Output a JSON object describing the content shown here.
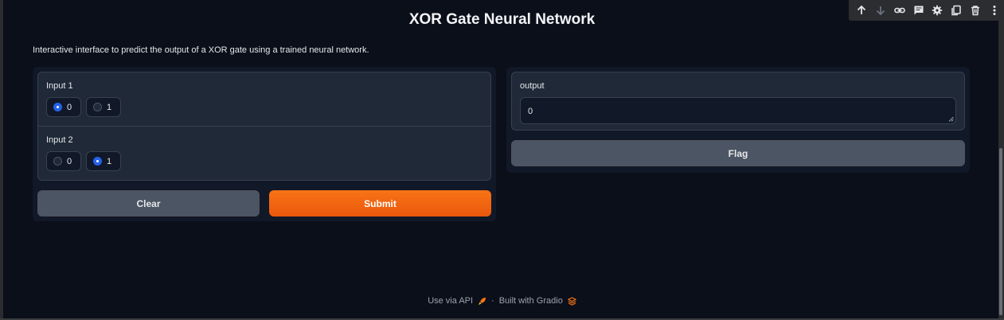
{
  "header": {
    "title": "XOR Gate Neural Network",
    "description": "Interactive interface to predict the output of a XOR gate using a trained neural network."
  },
  "toolbar": {
    "icons": [
      "arrow-up-icon",
      "arrow-down-icon",
      "link-icon",
      "comment-icon",
      "gear-icon",
      "copy-icon",
      "trash-icon",
      "more-vertical-icon"
    ]
  },
  "inputs": {
    "input1": {
      "label": "Input 1",
      "options": [
        "0",
        "1"
      ],
      "selected": "0"
    },
    "input2": {
      "label": "Input 2",
      "options": [
        "0",
        "1"
      ],
      "selected": "1"
    }
  },
  "buttons": {
    "clear": "Clear",
    "submit": "Submit",
    "flag": "Flag"
  },
  "output": {
    "label": "output",
    "value": "0"
  },
  "footer": {
    "api_text": "Use via API",
    "separator": "·",
    "built_with": "Built with Gradio"
  },
  "colors": {
    "background": "#0b0f19",
    "panel": "#111827",
    "block": "#1f2937",
    "accent": "#f97316",
    "radio_checked": "#2563eb"
  }
}
